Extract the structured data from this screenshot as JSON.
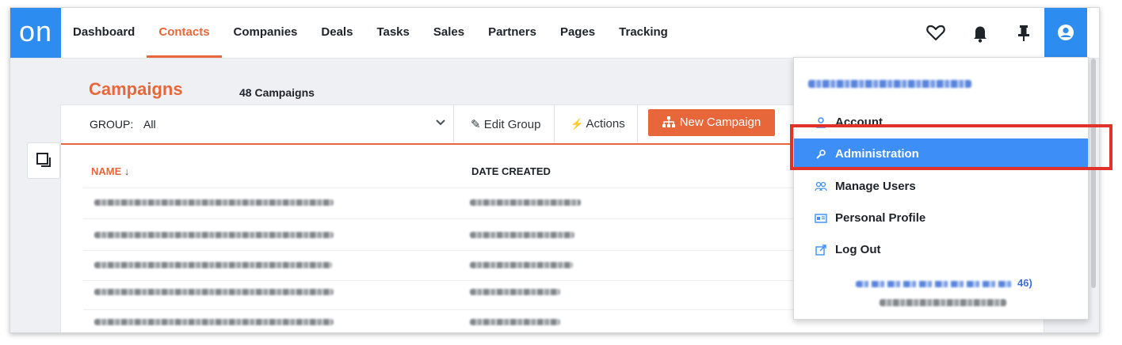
{
  "logo": {
    "text": "on",
    "bg": "#2d8cf0"
  },
  "nav": {
    "items": [
      {
        "label": "Dashboard",
        "active": false
      },
      {
        "label": "Contacts",
        "active": true
      },
      {
        "label": "Companies",
        "active": false
      },
      {
        "label": "Deals",
        "active": false
      },
      {
        "label": "Tasks",
        "active": false
      },
      {
        "label": "Sales",
        "active": false
      },
      {
        "label": "Partners",
        "active": false
      },
      {
        "label": "Pages",
        "active": false
      },
      {
        "label": "Tracking",
        "active": false
      }
    ],
    "icons": [
      "heart-icon",
      "bell-icon",
      "pin-icon",
      "user-circle-icon"
    ]
  },
  "page": {
    "title": "Campaigns",
    "count_label": "48 Campaigns"
  },
  "toolbar": {
    "group_label": "GROUP:",
    "group_value": "All",
    "edit_group": "Edit Group",
    "actions": "Actions",
    "new_campaign": "New Campaign"
  },
  "table": {
    "columns": [
      {
        "label": "NAME",
        "sorted": true
      },
      {
        "label": "DATE CREATED"
      }
    ]
  },
  "user_menu": {
    "items": [
      {
        "label": "Account",
        "icon": "person-icon",
        "highlighted": false
      },
      {
        "label": "Administration",
        "icon": "wrench-icon",
        "highlighted": true
      },
      {
        "label": "Manage Users",
        "icon": "users-icon",
        "highlighted": false
      },
      {
        "label": "Personal Profile",
        "icon": "id-card-icon",
        "highlighted": false
      },
      {
        "label": "Log Out",
        "icon": "external-link-icon",
        "highlighted": false
      }
    ],
    "footer_suffix": "46)"
  },
  "colors": {
    "accent": "#e8673a",
    "primary": "#2d8cf0",
    "highlight_box": "#e03228"
  }
}
